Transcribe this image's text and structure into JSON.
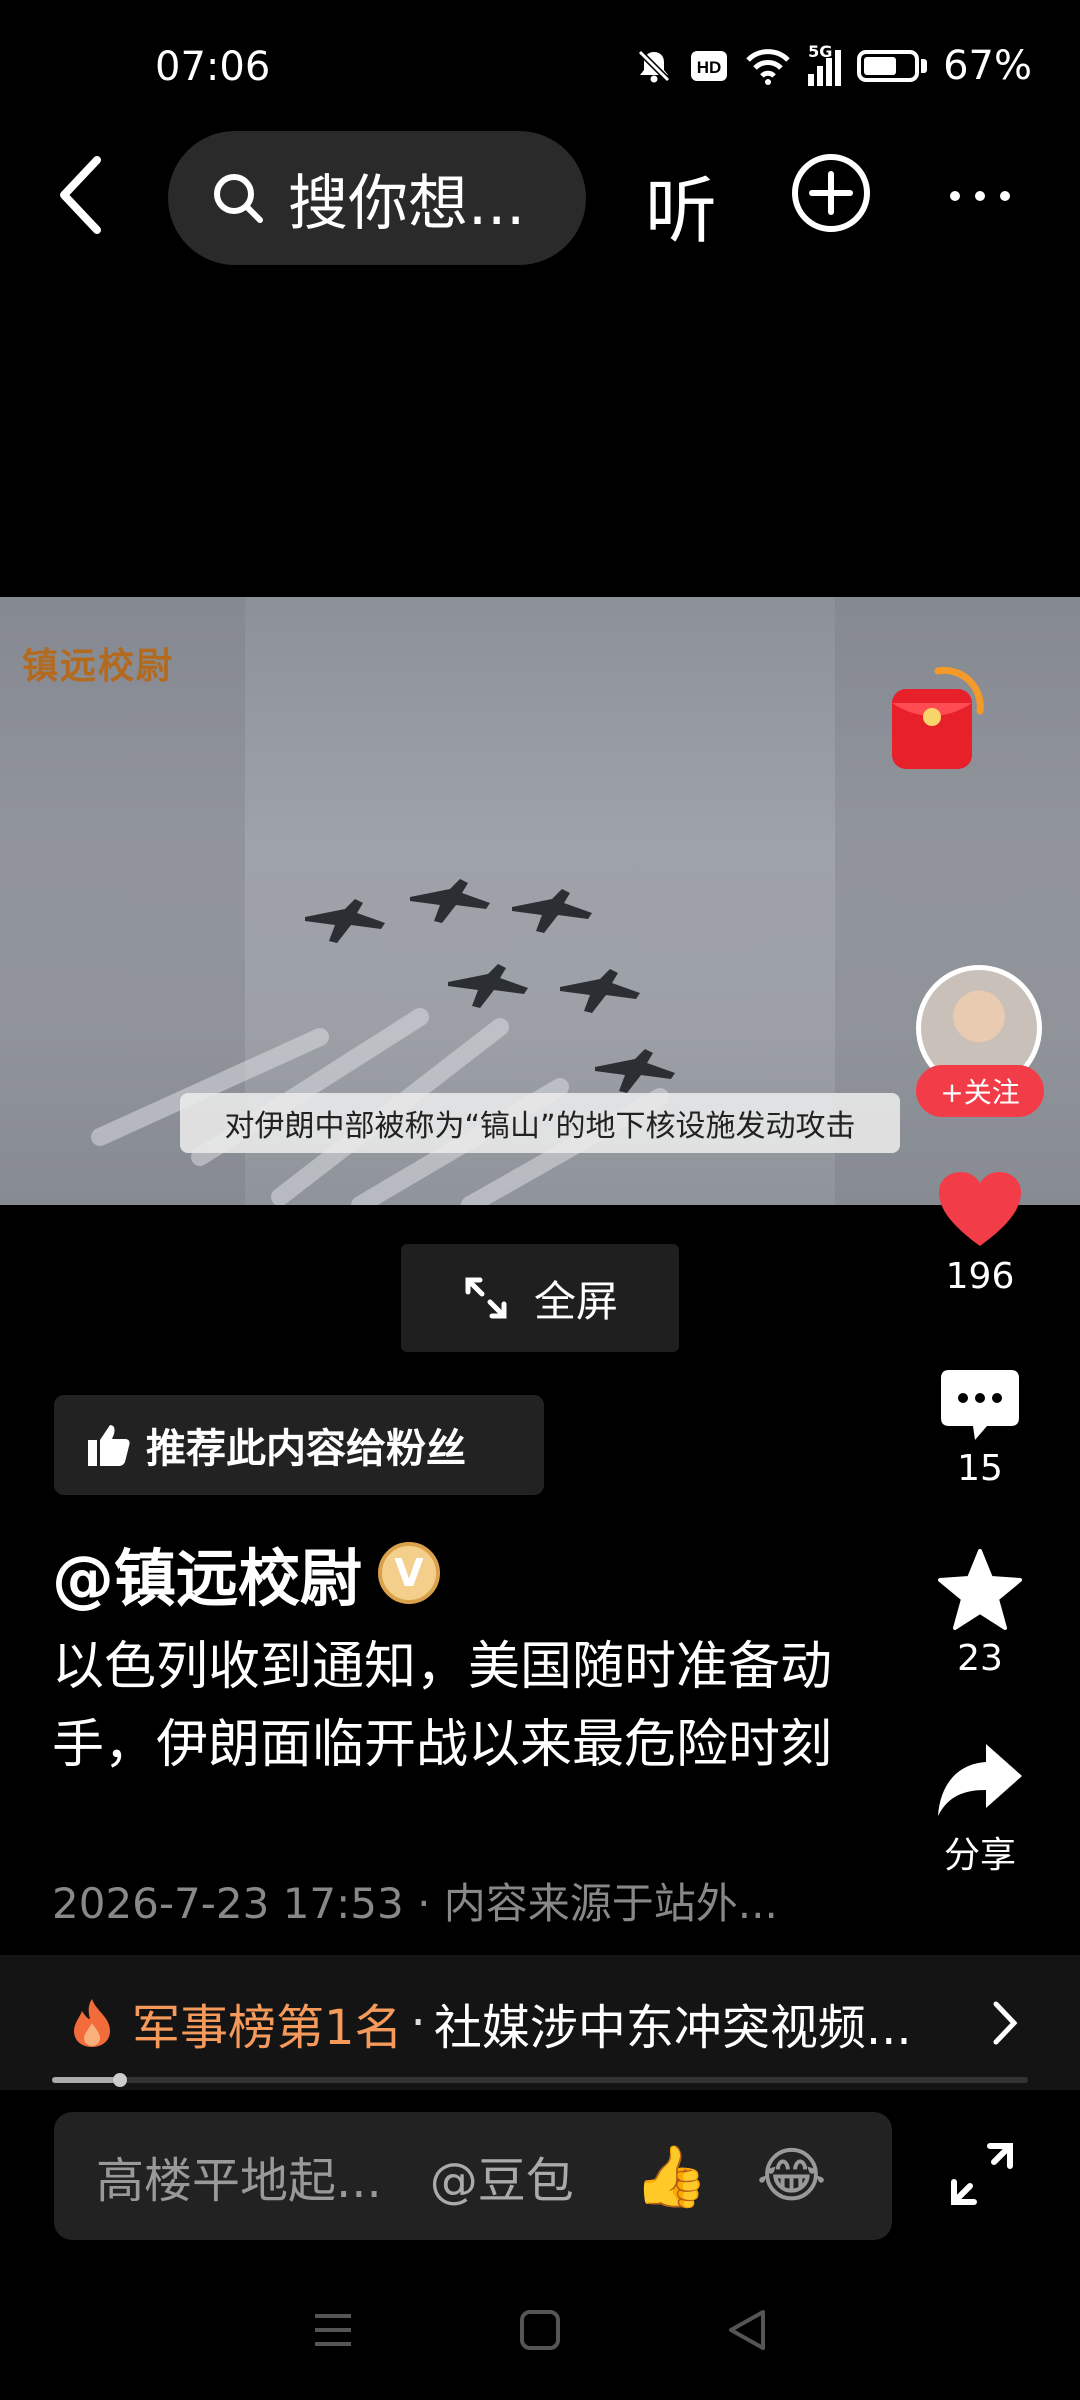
{
  "status_bar": {
    "time": "07:06",
    "network": "5G",
    "battery": "67%",
    "battery_level": 0.67
  },
  "top_nav": {
    "search_placeholder": "搜你想...",
    "listen_label": "听"
  },
  "video": {
    "watermark": "镇远校尉",
    "subtitle": "对伊朗中部被称为“镐山”的地下核设施发动攻击",
    "fullscreen_label": "全屏"
  },
  "author_side": {
    "follow_label": "+关注"
  },
  "actions": {
    "like_count": "196",
    "comment_count": "15",
    "favorite_count": "23",
    "share_label": "分享"
  },
  "post": {
    "recommend_label": "推荐此内容给粉丝",
    "author": "@镇远校尉",
    "verified_badge": "V",
    "description": "以色列收到通知，美国随时准备动手，伊朗面临开战以来最危险时刻",
    "meta": "2026-7-23 17:53 · 内容来源于站外..."
  },
  "ranking": {
    "rank_label": "军事榜第1名",
    "separator": "·",
    "topic": "社媒涉中东冲突视频..."
  },
  "progress": {
    "fraction": 0.07
  },
  "comment_bar": {
    "placeholder": "高楼平地起...",
    "mention": "@豆包"
  },
  "colors": {
    "accent_red": "#f23c48",
    "hot_orange": "#f59a5b"
  }
}
